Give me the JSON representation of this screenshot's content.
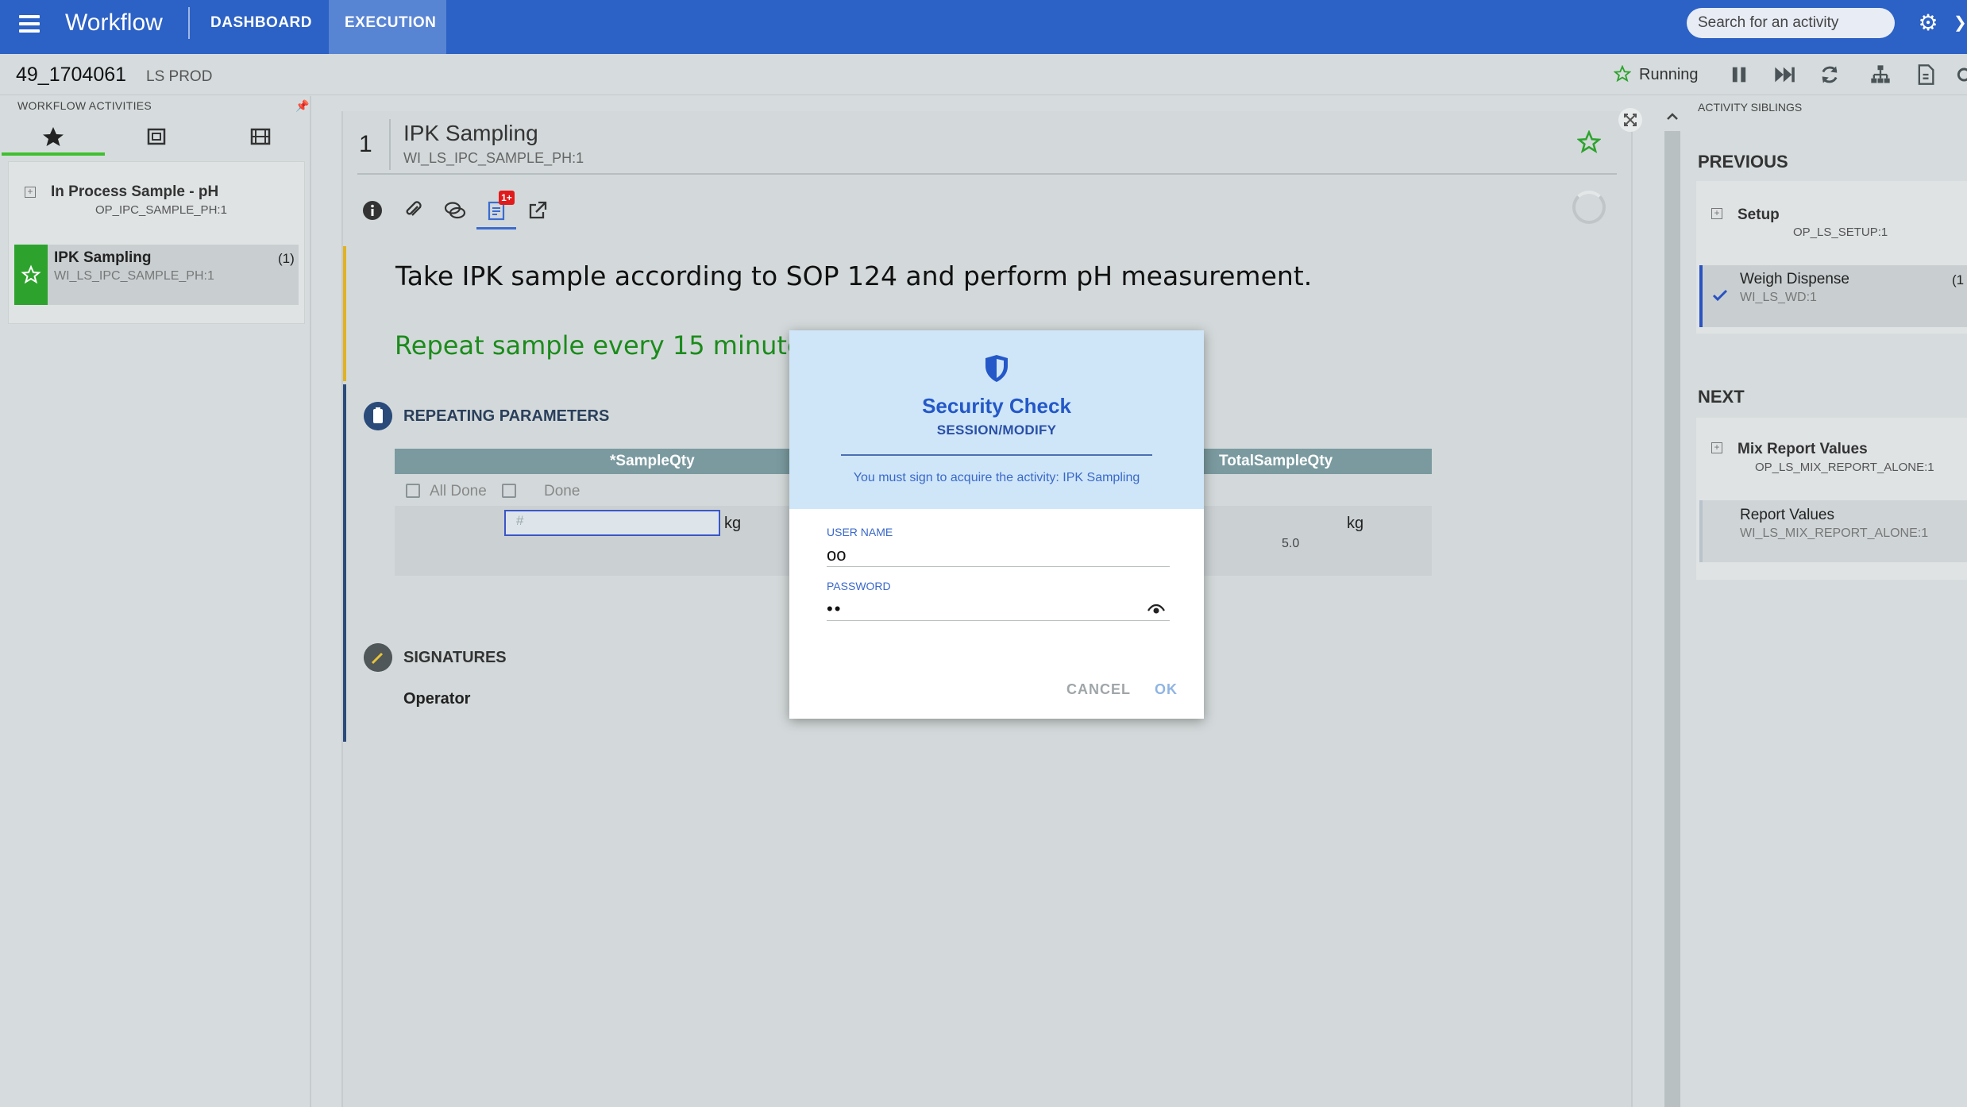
{
  "header": {
    "app_title": "Workflow",
    "tabs": [
      {
        "label": "DASHBOARD",
        "active": false
      },
      {
        "label": "EXECUTION",
        "active": true
      }
    ],
    "search_placeholder": "Search for an activity"
  },
  "subheader": {
    "order_id": "49_1704061",
    "environment": "LS PROD",
    "status": "Running"
  },
  "left_panel": {
    "title": "WORKFLOW ACTIVITIES",
    "items": [
      {
        "title": "In Process Sample - pH",
        "code": "OP_IPC_SAMPLE_PH:1"
      },
      {
        "title": "IPK Sampling",
        "code": "WI_LS_IPC_SAMPLE_PH:1",
        "count": "(1)"
      }
    ]
  },
  "activity": {
    "step_number": "1",
    "title": "IPK Sampling",
    "code": "WI_LS_IPC_SAMPLE_PH:1",
    "notification_count": "1+",
    "instruction": "Take IPK sample according to SOP 124 and perform pH measurement.",
    "repeat_note": "Repeat sample every 15 minutes [1",
    "repeating_params_label": "REPEATING PARAMETERS",
    "table": {
      "col_sample": "*SampleQty",
      "col_total": "TotalSampleQty",
      "all_done_label": "All Done",
      "done_label": "Done",
      "input_placeholder": "#",
      "sample_unit": "kg",
      "total_unit": "kg",
      "total_value": "5.0"
    },
    "signatures_label": "SIGNATURES",
    "operator_label": "Operator"
  },
  "right_panel": {
    "title": "ACTIVITY SIBLINGS",
    "previous_heading": "PREVIOUS",
    "previous": [
      {
        "title": "Setup",
        "code": "OP_LS_SETUP:1"
      },
      {
        "title": "Weigh Dispense",
        "code": "WI_LS_WD:1",
        "count": "(1"
      }
    ],
    "next_heading": "NEXT",
    "next": [
      {
        "title": "Mix Report Values",
        "code": "OP_LS_MIX_REPORT_ALONE:1"
      },
      {
        "title": "Report Values",
        "code": "WI_LS_MIX_REPORT_ALONE:1"
      }
    ]
  },
  "dialog": {
    "title": "Security Check",
    "subtitle": "SESSION/MODIFY",
    "message": "You must sign to acquire the activity: IPK Sampling",
    "username_label": "USER NAME",
    "username_value": "oo",
    "password_label": "PASSWORD",
    "password_value": "oo",
    "cancel_label": "CANCEL",
    "ok_label": "OK"
  },
  "colors": {
    "header_blue": "#2c61c5",
    "active_tab": "#5884d4",
    "success_green": "#2da32d",
    "dialog_title": "#2458c8"
  }
}
